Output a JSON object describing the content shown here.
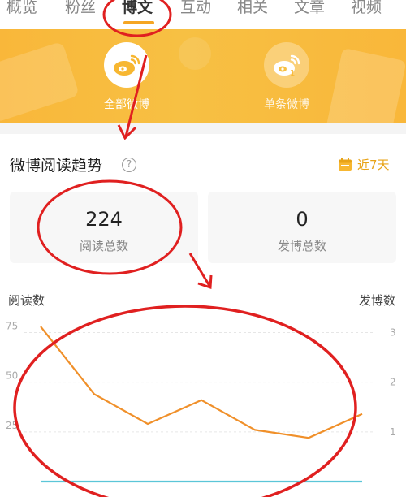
{
  "tabs": [
    {
      "label": "概览"
    },
    {
      "label": "粉丝"
    },
    {
      "label": "博文"
    },
    {
      "label": "互动"
    },
    {
      "label": "相关"
    },
    {
      "label": "文章"
    },
    {
      "label": "视频"
    }
  ],
  "active_tab": "博文",
  "banner": {
    "options": [
      {
        "label": "全部微博",
        "icon": "weibo-logo-icon",
        "active": true
      },
      {
        "label": "单条微博",
        "icon": "single-weibo-icon",
        "active": false
      }
    ]
  },
  "section": {
    "title": "微博阅读趋势",
    "help": "?",
    "date_range": "近7天",
    "date_icon": "calendar-icon"
  },
  "metrics": [
    {
      "value": "224",
      "label": "阅读总数"
    },
    {
      "value": "0",
      "label": "发博总数"
    }
  ],
  "colors": {
    "accent": "#f7b731",
    "read_line": "#f0902a",
    "post_line": "#5bc6d8",
    "annotation": "#e02020"
  },
  "chart_data": {
    "type": "line",
    "left_axis_label": "阅读数",
    "right_axis_label": "发博数",
    "left_ticks": [
      {
        "label": "75",
        "value": 75
      },
      {
        "label": "50",
        "value": 50
      },
      {
        "label": "25",
        "value": 25
      }
    ],
    "right_ticks": [
      {
        "label": "3",
        "value": 3
      },
      {
        "label": "2",
        "value": 2
      },
      {
        "label": "1",
        "value": 1
      }
    ],
    "ylim_left": [
      0,
      85
    ],
    "ylim_right": [
      0,
      3.4
    ],
    "grid": true,
    "series": [
      {
        "axis": "left",
        "values": [
          78,
          44,
          29,
          41,
          26,
          22,
          34
        ]
      },
      {
        "axis": "right",
        "values": [
          0,
          0,
          0,
          0,
          0,
          0,
          0
        ]
      }
    ]
  }
}
